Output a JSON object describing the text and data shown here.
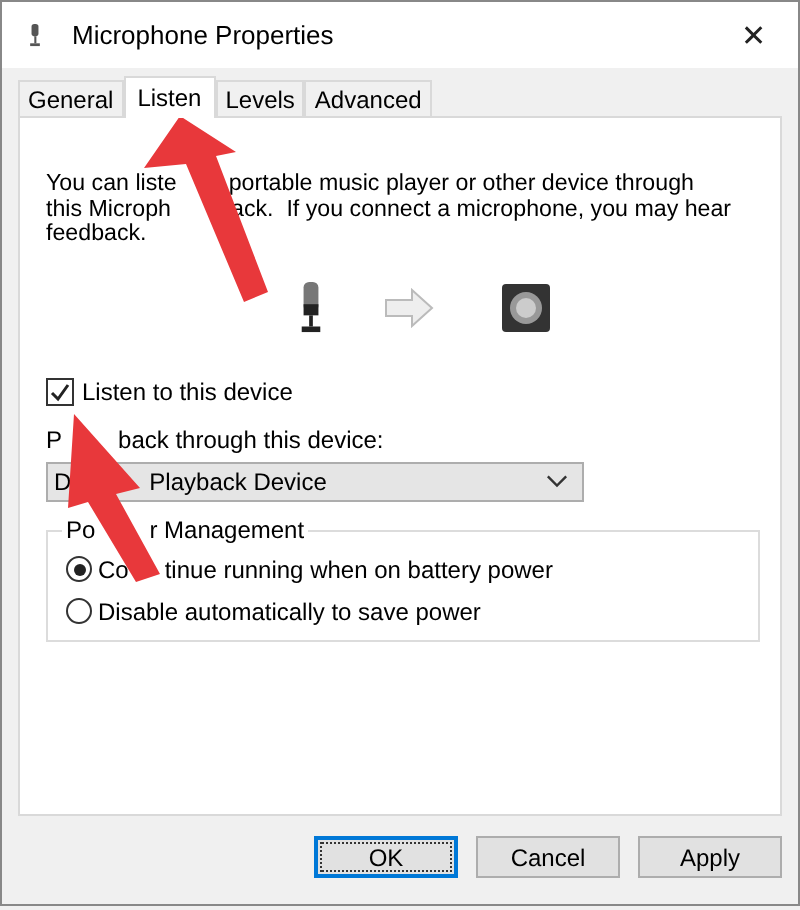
{
  "window": {
    "title": "Microphone Properties",
    "close": "✕"
  },
  "tabs": [
    {
      "label": "General",
      "selected": false
    },
    {
      "label": "Listen",
      "selected": true
    },
    {
      "label": "Levels",
      "selected": false
    },
    {
      "label": "Advanced",
      "selected": false
    }
  ],
  "description_lines": [
    {
      "parts": [
        "You can liste",
        "portable music player or other device through"
      ]
    },
    {
      "parts": [
        "this Microph",
        "ack.  If you connect a microphone, you may hear"
      ]
    },
    {
      "parts": [
        "feedback."
      ]
    }
  ],
  "listen_checkbox": {
    "label": "Listen to this device",
    "checked": true
  },
  "playback": {
    "label_parts": [
      "P",
      "back through this device:"
    ],
    "value_parts": [
      "D",
      "Playback Device"
    ]
  },
  "power_management": {
    "title_parts": [
      "Po",
      "r Management"
    ],
    "options": [
      {
        "label_parts": [
          "Co",
          "tinue running when on battery power"
        ],
        "selected": true
      },
      {
        "label_parts": [
          "Disable automatically to save power"
        ],
        "selected": false
      }
    ]
  },
  "buttons": [
    {
      "label": "OK",
      "default": true
    },
    {
      "label": "Cancel",
      "default": false
    },
    {
      "label": "Apply",
      "default": false
    }
  ],
  "annotations": [
    {
      "kind": "arrow"
    },
    {
      "kind": "arrow"
    }
  ]
}
